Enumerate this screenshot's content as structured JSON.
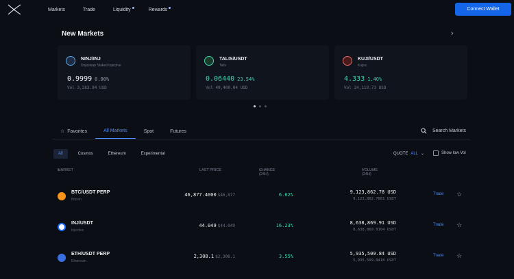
{
  "nav": {
    "links": [
      "Markets",
      "Trade",
      "Liquidity",
      "Rewards"
    ],
    "connect": "Connect Wallet"
  },
  "new_markets": {
    "title": "New Markets",
    "cards": [
      {
        "pair": "NINJ/INJ",
        "name": "Dojoswap Staked Injective",
        "price": "0.9999",
        "change": "0.00%",
        "volume": "Vol 3,283.94 USD",
        "icon_color": "#1f2a44"
      },
      {
        "pair": "TALIS/USDT",
        "name": "Talis",
        "price": "0.06440",
        "change": "23.54%",
        "volume": "Vol 49,409.04 USD",
        "icon_color": "#1a3a2a"
      },
      {
        "pair": "KUJI/USDT",
        "name": "Kujira",
        "price": "4.333",
        "change": "1.40%",
        "volume": "Vol 24,119.73 USD",
        "icon_color": "#4a1a1a"
      }
    ]
  },
  "tabs": [
    "Favorites",
    "All Markets",
    "Spot",
    "Futures"
  ],
  "search": "Search Markets",
  "filters": [
    "All",
    "Cosmos",
    "Ethereum",
    "Experimental"
  ],
  "quote": {
    "label": "QUOTE",
    "value": "ALL"
  },
  "low_vol": "Show low Vol",
  "table": {
    "headers": {
      "market": "MARKET",
      "price": "LAST PRICE",
      "change": "CHANGE (24H)",
      "volume": "VOLUME (24H)"
    },
    "rows": [
      {
        "market": "BTC/USDT PERP",
        "sub": "Bitcoin",
        "price": "46,877.4000",
        "price_usd": "$46,877",
        "change": "6.62%",
        "vol": "9,123,862.78 USD",
        "vol_sub": "9,123,862.7881 USDT",
        "trade": "Trade",
        "coin_color": "#f7931a"
      },
      {
        "market": "INJ/USDT",
        "sub": "Injective",
        "price": "44.049",
        "price_usd": "$44.049",
        "change": "16.23%",
        "vol": "8,638,869.91 USD",
        "vol_sub": "8,638,869.9104 USDT",
        "trade": "Trade",
        "coin_color": "#1b6bff"
      },
      {
        "market": "ETH/USDT PERP",
        "sub": "Ethereum",
        "price": "2,308.1",
        "price_usd": "$2,308.1",
        "change": "3.55%",
        "vol": "5,935,509.84 USD",
        "vol_sub": "5,935,509.8418 USDT",
        "trade": "Trade",
        "coin_color": "#3b6fe0"
      }
    ]
  }
}
